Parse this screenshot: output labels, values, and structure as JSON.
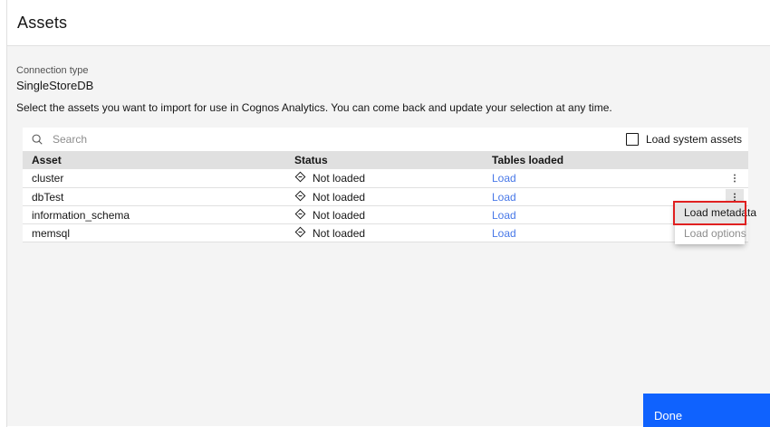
{
  "header": {
    "title": "Assets"
  },
  "connection": {
    "label": "Connection type",
    "value": "SingleStoreDB"
  },
  "description": "Select the assets you want to import for use in Cognos Analytics. You can come back and update your selection at any time.",
  "toolbar": {
    "search_placeholder": "Search",
    "checkbox_label": "Load system assets",
    "checkbox_checked": false
  },
  "table": {
    "columns": [
      "Asset",
      "Status",
      "Tables loaded"
    ],
    "rows": [
      {
        "asset": "cluster",
        "status": "Not loaded",
        "action": "Load"
      },
      {
        "asset": "dbTest",
        "status": "Not loaded",
        "action": "Load"
      },
      {
        "asset": "information_schema",
        "status": "Not loaded",
        "action": "Load"
      },
      {
        "asset": "memsql",
        "status": "Not loaded",
        "action": "Load"
      }
    ]
  },
  "context_menu": {
    "items": [
      {
        "label": "Load metadata",
        "highlighted": true
      },
      {
        "label": "Load options",
        "highlighted": false
      }
    ],
    "annotation_color": "#e02020"
  },
  "footer": {
    "done_label": "Done"
  },
  "colors": {
    "accent": "#0f62fe",
    "link": "#4878e8",
    "body_bg": "#f4f4f4",
    "table_header_bg": "#e0e0e0",
    "text": "#161616",
    "secondary_text": "#525252"
  }
}
